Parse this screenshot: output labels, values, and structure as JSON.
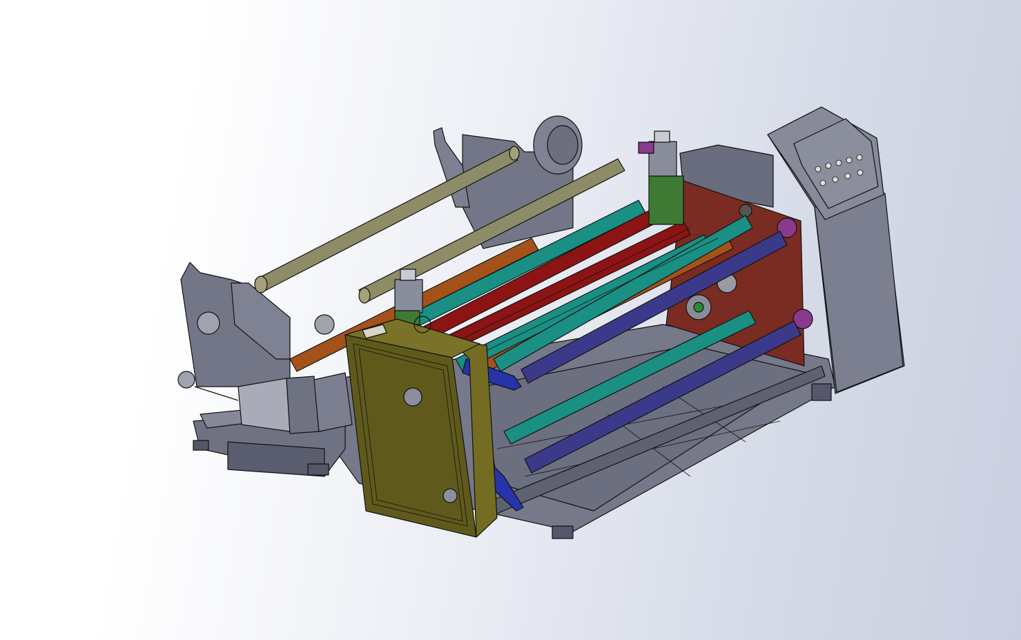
{
  "scene": {
    "type": "cad-3d-assembly-view",
    "subject": "slitting-rewinding-machine"
  },
  "colors": {
    "background_light": "#ffffff",
    "background_dark": "#c9cfdf",
    "frame_gray": "#6d7080",
    "frame_dark": "#55586a",
    "frame_light": "#8d909e",
    "panel_red": "#7a2c22",
    "olive_box": "#5f5a1c",
    "olive_dark": "#433f12",
    "roller_teal": "#1a8f84",
    "roller_red": "#8c1414",
    "roller_orange": "#a4521a",
    "roller_purple": "#3b3a8a",
    "roller_khaki": "#8e8c66",
    "arm_blue": "#2733a8",
    "cylinder_silver": "#a9acb8",
    "bracket_green": "#3e7a34",
    "flange_magenta": "#8a3a8c"
  },
  "parts": [
    "control-cabinet",
    "control-panel",
    "rear-red-side-plate",
    "unwind-stands",
    "khaki-unwind-shafts",
    "colored-guide-rollers",
    "slitter-knife-holders",
    "olive-gearbox-housing",
    "blue-rewind-arms",
    "pneumatic-cylinder",
    "base-frame",
    "leveling-feet"
  ]
}
